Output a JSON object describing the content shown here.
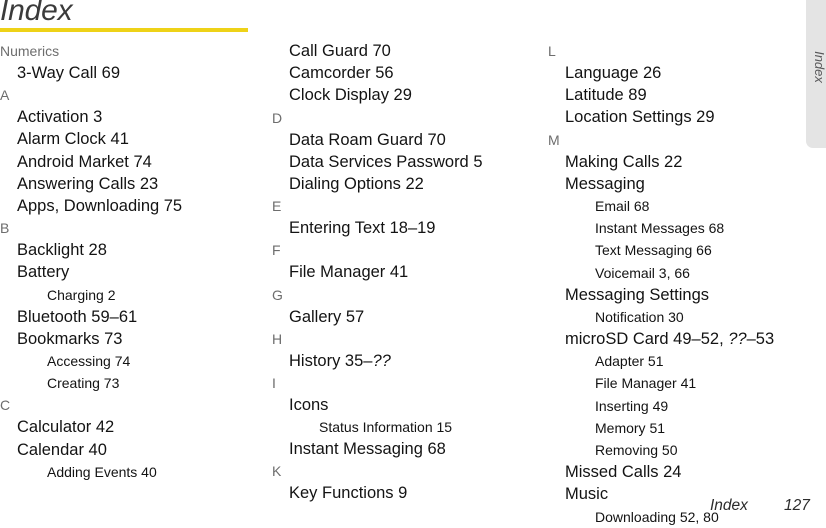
{
  "page": {
    "title": "Index",
    "rule_color": "#eed218"
  },
  "side_tab": {
    "label": "Index",
    "background_color": "#e4e4e4",
    "text_color": "#58585a"
  },
  "footer": {
    "label": "Index",
    "page_number": "127"
  },
  "columns": [
    {
      "name": "column-1",
      "blocks": [
        {
          "letter": "Numerics",
          "items": [
            {
              "type": "entry",
              "text": "3-Way Call 69"
            }
          ]
        },
        {
          "letter": "A",
          "items": [
            {
              "type": "entry",
              "text": "Activation 3"
            },
            {
              "type": "entry",
              "text": "Alarm Clock 41"
            },
            {
              "type": "entry",
              "text": "Android Market 74"
            },
            {
              "type": "entry",
              "text": "Answering Calls 23"
            },
            {
              "type": "entry",
              "text": "Apps, Downloading 75"
            }
          ]
        },
        {
          "letter": "B",
          "items": [
            {
              "type": "entry",
              "text": "Backlight 28"
            },
            {
              "type": "entry",
              "text": "Battery"
            },
            {
              "type": "subentry",
              "text": "Charging 2"
            },
            {
              "type": "entry",
              "text": "Bluetooth 59–61"
            },
            {
              "type": "entry",
              "text": "Bookmarks 73"
            },
            {
              "type": "subentry",
              "text": "Accessing 74"
            },
            {
              "type": "subentry",
              "text": "Creating 73"
            }
          ]
        },
        {
          "letter": "C",
          "items": [
            {
              "type": "entry",
              "text": "Calculator 42"
            },
            {
              "type": "entry",
              "text": "Calendar 40"
            },
            {
              "type": "subentry",
              "text": "Adding Events 40"
            }
          ]
        }
      ]
    },
    {
      "name": "column-2",
      "blocks": [
        {
          "letter": "",
          "items": [
            {
              "type": "entry",
              "text": "Call Guard 70"
            },
            {
              "type": "entry",
              "text": "Camcorder 56"
            },
            {
              "type": "entry",
              "text": "Clock Display 29"
            }
          ]
        },
        {
          "letter": "D",
          "items": [
            {
              "type": "entry",
              "text": "Data Roam Guard 70"
            },
            {
              "type": "entry",
              "text": "Data Services Password 5"
            },
            {
              "type": "entry",
              "text": "Dialing Options 22"
            }
          ]
        },
        {
          "letter": "E",
          "items": [
            {
              "type": "entry",
              "text": "Entering Text 18–19"
            }
          ]
        },
        {
          "letter": "F",
          "items": [
            {
              "type": "entry",
              "text": "File Manager 41"
            }
          ]
        },
        {
          "letter": "G",
          "items": [
            {
              "type": "entry",
              "text": "Gallery 57"
            }
          ]
        },
        {
          "letter": "H",
          "items": [
            {
              "type": "entry",
              "text": "History 35–",
              "italic_suffix": "??"
            }
          ]
        },
        {
          "letter": "I",
          "items": [
            {
              "type": "entry",
              "text": "Icons"
            },
            {
              "type": "subentry",
              "text": "Status Information 15"
            },
            {
              "type": "entry",
              "text": "Instant Messaging 68"
            }
          ]
        },
        {
          "letter": "K",
          "items": [
            {
              "type": "entry",
              "text": "Key Functions 9"
            }
          ]
        }
      ]
    },
    {
      "name": "column-3",
      "blocks": [
        {
          "letter": "L",
          "items": [
            {
              "type": "entry",
              "text": "Language 26"
            },
            {
              "type": "entry",
              "text": "Latitude 89"
            },
            {
              "type": "entry",
              "text": "Location Settings 29"
            }
          ]
        },
        {
          "letter": "M",
          "items": [
            {
              "type": "entry",
              "text": "Making Calls 22"
            },
            {
              "type": "entry",
              "text": "Messaging"
            },
            {
              "type": "subentry",
              "text": "Email 68"
            },
            {
              "type": "subentry",
              "text": "Instant Messages 68"
            },
            {
              "type": "subentry",
              "text": "Text Messaging 66"
            },
            {
              "type": "subentry",
              "text": "Voicemail 3, 66"
            },
            {
              "type": "entry",
              "text": "Messaging Settings"
            },
            {
              "type": "subentry",
              "text": "Notification 30"
            },
            {
              "type": "entry",
              "text": "microSD Card 49–52, ",
              "italic_suffix": "??",
              "text_after": "–53"
            },
            {
              "type": "subentry",
              "text": "Adapter 51"
            },
            {
              "type": "subentry",
              "text": "File Manager 41"
            },
            {
              "type": "subentry",
              "text": "Inserting 49"
            },
            {
              "type": "subentry",
              "text": "Memory 51"
            },
            {
              "type": "subentry",
              "text": "Removing 50"
            },
            {
              "type": "entry",
              "text": "Missed Calls 24"
            },
            {
              "type": "entry",
              "text": "Music"
            },
            {
              "type": "subentry",
              "text": "Downloading 52, 80"
            }
          ]
        }
      ]
    }
  ]
}
